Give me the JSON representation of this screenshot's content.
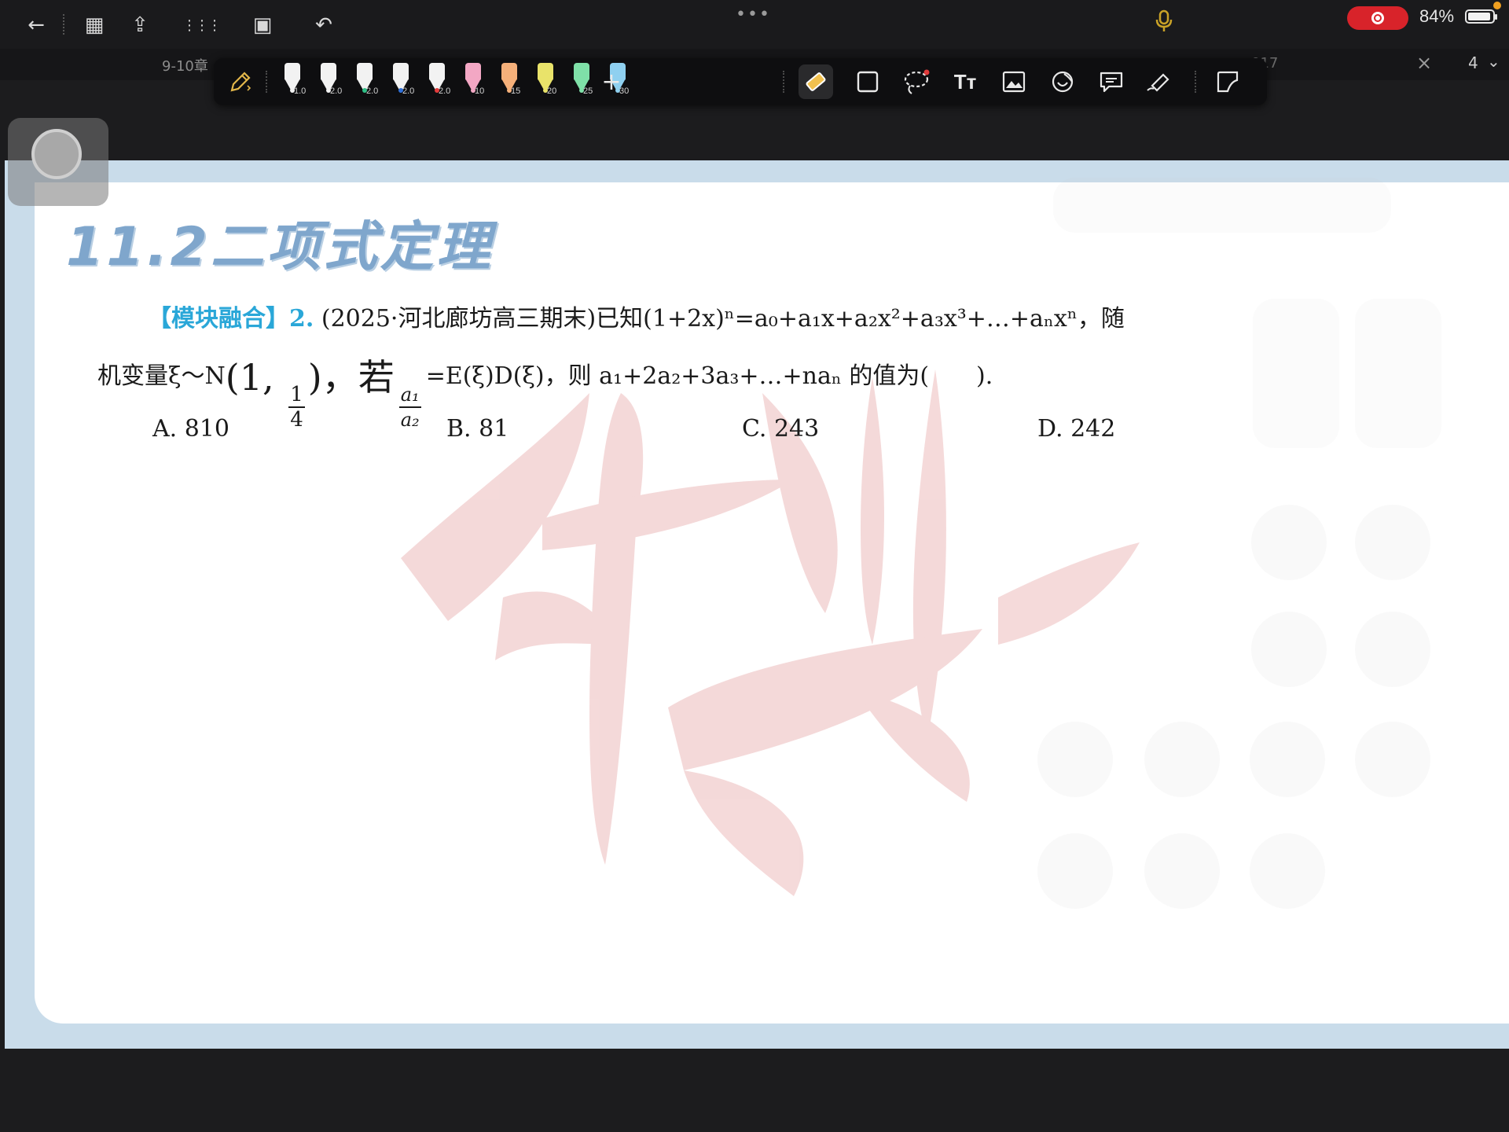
{
  "topbar": {
    "back_icon": "←",
    "grid_icon": "▦",
    "share_icon": "⇪",
    "apps_icon": "⋮⋮⋮",
    "layout_icon": "▣",
    "undo_icon": "↶",
    "more_icon": "•••",
    "mic_icon": "🎙",
    "battery_percent": "84%",
    "recording_color": "#d8232a"
  },
  "tabs": {
    "current_label": "9-10章",
    "right_label": "017",
    "close_icon": "×",
    "page_number": "4",
    "chevron_icon": "⌄"
  },
  "pen_toolbar": {
    "pens": [
      {
        "size": "1.0",
        "color": "#f2f2f2"
      },
      {
        "size": "2.0",
        "color": "#f2f2f2"
      },
      {
        "size": "2.0",
        "color": "#2fbf86"
      },
      {
        "size": "2.0",
        "color": "#2f6fd8"
      },
      {
        "size": "2.0",
        "color": "#e23b3b"
      },
      {
        "size": "10",
        "color": "#f3a7c4"
      },
      {
        "size": "15",
        "color": "#f5b07a"
      },
      {
        "size": "20",
        "color": "#e9e36a"
      },
      {
        "size": "25",
        "color": "#7fe0a8"
      },
      {
        "size": "30",
        "color": "#8fd0f0"
      }
    ],
    "add_icon": "+",
    "text_tool": "Tт"
  },
  "document": {
    "section_title": "11.2二项式定理",
    "question": {
      "tag": "【模块融合】",
      "number": "2.",
      "line1": "(2025·河北廊坊高三期末)已知(1+2x)ⁿ=a₀+a₁x+a₂x²+a₃x³+…+aₙxⁿ，随",
      "line2_prefix": "机变量ξ～N",
      "line2_paren": "(1, ",
      "fraction_num": "1",
      "fraction_den": "4",
      "line2_after_paren": ")，若",
      "frac2_num": "a₁",
      "frac2_den": "a₂",
      "line2_suffix": "=E(ξ)D(ξ)，则 a₁+2a₂+3a₃+…+naₙ 的值为(　　)."
    },
    "options": [
      {
        "label": "A.",
        "value": "810"
      },
      {
        "label": "B.",
        "value": "81"
      },
      {
        "label": "C.",
        "value": "243"
      },
      {
        "label": "D.",
        "value": "242"
      }
    ],
    "watermark_color": "#f0c8c8",
    "accent_color": "#2aa7d8",
    "title_color": "#7fa6cc"
  }
}
